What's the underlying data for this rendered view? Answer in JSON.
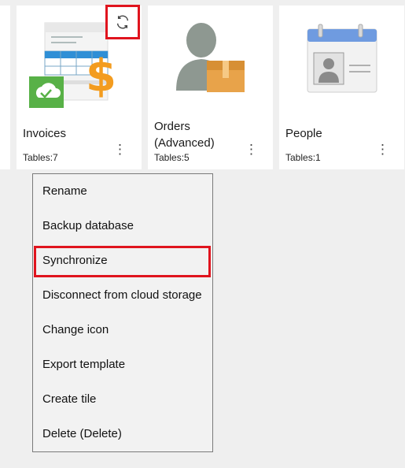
{
  "tiles": [
    {
      "title": "Invoices",
      "subtitle": "Tables:7",
      "more_icon": "⋮"
    },
    {
      "title": "Orders (Advanced)",
      "subtitle": "Tables:5",
      "more_icon": "⋮"
    },
    {
      "title": "People",
      "subtitle": "Tables:1",
      "more_icon": "⋮"
    }
  ],
  "sync_icon": "sync-icon",
  "context_menu": {
    "items": [
      "Rename",
      "Backup database",
      "Synchronize",
      "Disconnect from cloud storage",
      "Change icon",
      "Export template",
      "Create tile",
      "Delete (Delete)"
    ],
    "highlighted_index": 2
  },
  "colors": {
    "highlight": "#e0141e",
    "tile_background": "#ffffff",
    "page_background": "#efefef",
    "menu_background": "#f2f2f2"
  }
}
